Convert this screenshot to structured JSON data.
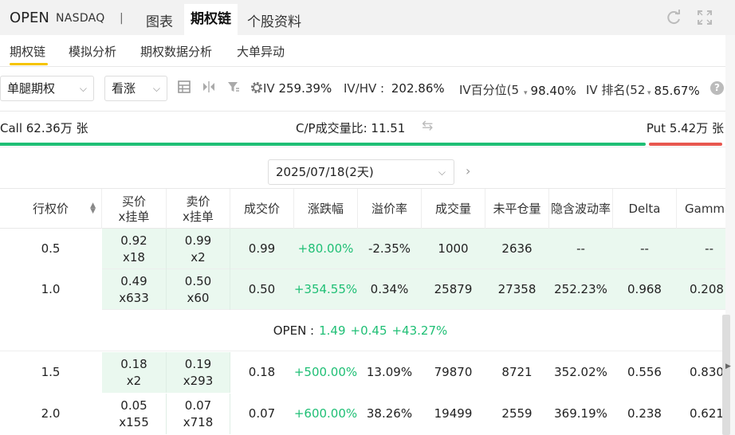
{
  "header": {
    "ticker": "OPEN",
    "exchange": "NASDAQ",
    "separator": "|",
    "tabs": [
      {
        "label": "图表"
      },
      {
        "label": "期权链"
      },
      {
        "label": "个股资料"
      }
    ],
    "refresh_icon": "refresh-icon",
    "expand_icon": "expand-icon"
  },
  "subnav": {
    "tabs": [
      {
        "label": "期权链"
      },
      {
        "label": "模拟分析"
      },
      {
        "label": "期权数据分析"
      },
      {
        "label": "大单异动"
      }
    ],
    "accent_color": "#f5c400"
  },
  "toolbar": {
    "strategy_select": "单腿期权",
    "direction_select": "看涨",
    "iv_label": "IV",
    "iv_value": "259.39%",
    "ivhv_label": "IV/HV :",
    "ivhv_value": "202.86%",
    "ivpct_label": "IV百分位(5",
    "ivpct_value": "98.40%",
    "ivrank_label": "IV 排名(52",
    "ivrank_value": "85.67%",
    "help": "?"
  },
  "cp": {
    "call": "Call 62.36万 张",
    "ratio": "C/P成交量比: 11.51",
    "put": "Put 5.42万 张",
    "call_color": "#1fbf75",
    "put_color": "#e8574f"
  },
  "expiry": {
    "selected": "2025/07/18(2天)",
    "next": "›"
  },
  "table": {
    "headers": {
      "strike": "行权价",
      "bid1": "买价",
      "bid2": "x挂单",
      "ask1": "卖价",
      "ask2": "x挂单",
      "last": "成交价",
      "chg": "涨跌幅",
      "prem": "溢价率",
      "vol": "成交量",
      "oi": "未平仓量",
      "iv": "隐含波动率",
      "delta": "Delta",
      "gamma": "Gamma"
    },
    "rows_above": [
      {
        "strike": "0.5",
        "bid": "0.92",
        "bidsz": "x18",
        "ask": "0.99",
        "asksz": "x2",
        "last": "0.99",
        "chg": "+80.00%",
        "prem": "-2.35%",
        "vol": "1000",
        "oi": "2636",
        "iv": "--",
        "delta": "--",
        "gamma": "--"
      },
      {
        "strike": "1.0",
        "bid": "0.49",
        "bidsz": "x633",
        "ask": "0.50",
        "asksz": "x60",
        "last": "0.50",
        "chg": "+354.55%",
        "prem": "0.34%",
        "vol": "25879",
        "oi": "27358",
        "iv": "252.23%",
        "delta": "0.968",
        "gamma": "0.208"
      }
    ],
    "price_line": {
      "symbol": "OPEN :",
      "price": "1.49",
      "change": "+0.45",
      "pct": "+43.27%"
    },
    "rows_below": [
      {
        "strike": "1.5",
        "bid": "0.18",
        "bidsz": "x2",
        "ask": "0.19",
        "asksz": "x293",
        "last": "0.18",
        "chg": "+500.00%",
        "prem": "13.09%",
        "vol": "79870",
        "oi": "8721",
        "iv": "352.02%",
        "delta": "0.556",
        "gamma": "0.830"
      },
      {
        "strike": "2.0",
        "bid": "0.05",
        "bidsz": "x155",
        "ask": "0.07",
        "asksz": "x718",
        "last": "0.07",
        "chg": "+600.00%",
        "prem": "38.26%",
        "vol": "19499",
        "oi": "2559",
        "iv": "369.19%",
        "delta": "0.238",
        "gamma": "0.621"
      }
    ],
    "itm_color": "#eaf8ef",
    "up_color": "#1fbf75"
  }
}
